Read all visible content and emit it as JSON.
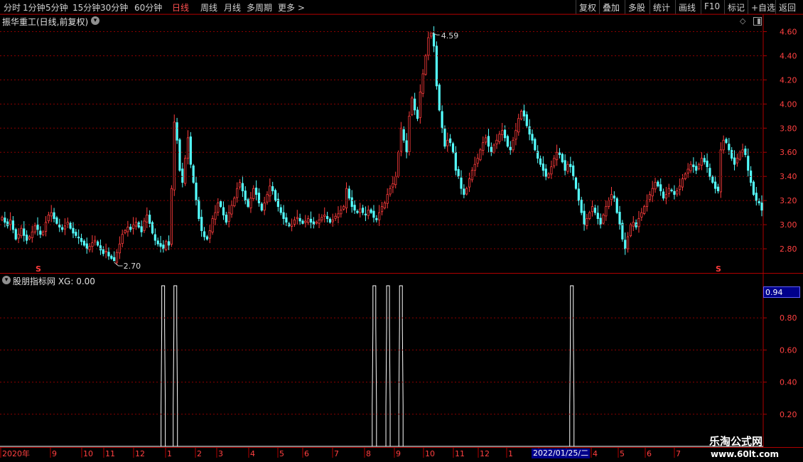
{
  "toolbar": {
    "periods": [
      "分时",
      "1分钟",
      "5分钟",
      "15分钟",
      "30分钟",
      "60分钟",
      "日线",
      "周线",
      "月线",
      "多周期",
      "更多 >"
    ],
    "active_period": "日线",
    "tools": [
      "复权",
      "叠加",
      "多股",
      "统计",
      "画线",
      "F10",
      "标记",
      "+自选",
      "返回"
    ]
  },
  "main_chart": {
    "title": "振华重工(日线,前复权)",
    "high_label": "4.59",
    "low_label": "2.70",
    "y_ticks": [
      "4.60",
      "4.40",
      "4.20",
      "4.00",
      "3.80",
      "3.60",
      "3.40",
      "3.20",
      "3.00",
      "2.80"
    ],
    "s_marker": "S"
  },
  "indicator": {
    "title": "股朋指标网 XG: 0.00",
    "current_value": "0.94",
    "y_ticks": [
      "0.80",
      "0.60",
      "0.40",
      "0.20"
    ]
  },
  "time_axis": {
    "labels": [
      "2020年",
      "9",
      "10",
      "11",
      "12",
      "1",
      "2",
      "3",
      "4",
      "5",
      "6",
      "7",
      "8",
      "9",
      "10",
      "11",
      "12",
      "1",
      "2",
      "3",
      "4",
      "5",
      "6",
      "7"
    ],
    "selected_date": "2022/01/25/二"
  },
  "watermark": {
    "name": "乐淘公式网",
    "url": "www.60lt.com"
  },
  "colors": {
    "up": "#ff3c3c",
    "down": "#54ffff",
    "grid": "#8b0000",
    "axis_text": "#ff4040"
  },
  "chart_data": {
    "type": "candlestick",
    "price_ylim": [
      2.6,
      4.65
    ],
    "closes": [
      3.06,
      3.02,
      2.99,
      3.04,
      2.96,
      2.88,
      2.92,
      2.97,
      2.91,
      2.87,
      2.9,
      2.94,
      2.99,
      2.96,
      2.92,
      2.94,
      3.02,
      3.08,
      3.1,
      3.05,
      3.01,
      2.98,
      2.96,
      2.99,
      3.02,
      2.97,
      2.93,
      2.91,
      2.89,
      2.86,
      2.83,
      2.8,
      2.82,
      2.85,
      2.87,
      2.83,
      2.79,
      2.76,
      2.78,
      2.74,
      2.72,
      2.7,
      2.77,
      2.84,
      2.92,
      2.95,
      2.98,
      2.96,
      3.0,
      3.02,
      2.98,
      2.94,
      3.03,
      3.08,
      3.01,
      2.93,
      2.87,
      2.84,
      2.82,
      2.8,
      2.86,
      2.83,
      3.3,
      3.85,
      3.7,
      3.45,
      3.35,
      3.55,
      3.72,
      3.5,
      3.35,
      3.2,
      3.05,
      2.95,
      2.9,
      2.88,
      2.95,
      3.05,
      3.1,
      3.18,
      3.15,
      3.08,
      3.02,
      3.1,
      3.16,
      3.22,
      3.3,
      3.35,
      3.28,
      3.2,
      3.15,
      3.22,
      3.3,
      3.25,
      3.18,
      3.12,
      3.18,
      3.25,
      3.32,
      3.28,
      3.2,
      3.15,
      3.1,
      3.05,
      3.02,
      2.99,
      3.0,
      3.04,
      3.06,
      3.03,
      3.01,
      3.03,
      3.05,
      3.02,
      3.0,
      3.02,
      3.04,
      3.06,
      3.08,
      3.05,
      3.02,
      3.04,
      3.07,
      3.09,
      3.12,
      3.15,
      3.3,
      3.22,
      3.15,
      3.12,
      3.1,
      3.13,
      3.1,
      3.08,
      3.12,
      3.1,
      3.06,
      3.04,
      3.1,
      3.15,
      3.18,
      3.25,
      3.3,
      3.34,
      3.4,
      3.6,
      3.8,
      3.7,
      3.6,
      3.9,
      4.05,
      3.95,
      3.88,
      4.1,
      4.25,
      4.4,
      4.55,
      4.59,
      4.48,
      4.15,
      3.95,
      3.8,
      3.65,
      3.7,
      3.68,
      3.6,
      3.45,
      3.4,
      3.3,
      3.25,
      3.3,
      3.38,
      3.45,
      3.5,
      3.55,
      3.62,
      3.68,
      3.72,
      3.65,
      3.6,
      3.66,
      3.7,
      3.75,
      3.78,
      3.72,
      3.65,
      3.62,
      3.7,
      3.78,
      3.88,
      3.94,
      3.9,
      3.82,
      3.75,
      3.7,
      3.62,
      3.55,
      3.5,
      3.45,
      3.4,
      3.42,
      3.48,
      3.55,
      3.6,
      3.58,
      3.52,
      3.45,
      3.5,
      3.48,
      3.4,
      3.3,
      3.2,
      3.1,
      3.0,
      3.05,
      3.1,
      3.15,
      3.1,
      3.05,
      3.0,
      3.08,
      3.15,
      3.2,
      3.25,
      3.22,
      3.1,
      3.0,
      2.88,
      2.8,
      2.9,
      3.0,
      3.02,
      2.98,
      3.05,
      3.1,
      3.15,
      3.2,
      3.25,
      3.3,
      3.35,
      3.32,
      3.28,
      3.22,
      3.25,
      3.3,
      3.28,
      3.25,
      3.28,
      3.32,
      3.38,
      3.42,
      3.46,
      3.5,
      3.48,
      3.45,
      3.5,
      3.55,
      3.52,
      3.48,
      3.4,
      3.35,
      3.3,
      3.28,
      3.62,
      3.7,
      3.68,
      3.62,
      3.55,
      3.5,
      3.55,
      3.6,
      3.62,
      3.58,
      3.45,
      3.35,
      3.25,
      3.2,
      3.18,
      3.12
    ],
    "signal_positions": [
      0.212,
      0.228,
      0.49,
      0.508,
      0.525,
      0.75
    ],
    "signal_ylim": [
      0,
      1.0
    ]
  }
}
